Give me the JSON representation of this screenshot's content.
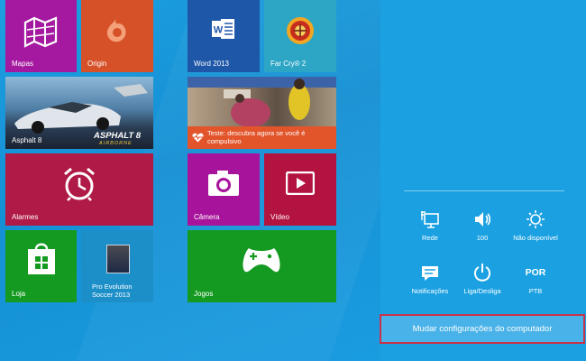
{
  "tiles": {
    "mapas": "Mapas",
    "origin": "Origin",
    "word": "Word 2013",
    "farcry": "Far Cry® 2",
    "asphalt": "Asphalt 8",
    "asphalt_logo": "ASPHALT 8",
    "asphalt_logo_sub": "AIRBORNE",
    "news_text": "Teste: descubra agora se você é compulsivo",
    "alarmes": "Alarmes",
    "camera": "Câmera",
    "video": "Vídeo",
    "loja": "Loja",
    "pes": "Pro Evolution Soccer 2013",
    "jogos": "Jogos"
  },
  "settings": {
    "network": "Rede",
    "volume": "100",
    "brightness": "Não disponível",
    "notifications": "Notificações",
    "power": "Liga/Desliga",
    "keyboard_code": "POR",
    "keyboard": "PTB",
    "pc_settings": "Mudar configurações do computador"
  },
  "colors": {
    "accent": "#1ba1e2",
    "highlight_border": "#c8334a"
  },
  "icons": [
    "maps-icon",
    "origin-icon",
    "word-icon",
    "farcry-icon",
    "alarm-clock-icon",
    "camera-icon",
    "video-icon",
    "store-icon",
    "gamepad-icon",
    "network-icon",
    "volume-icon",
    "brightness-icon",
    "notifications-icon",
    "power-icon",
    "heart-pulse-icon"
  ]
}
